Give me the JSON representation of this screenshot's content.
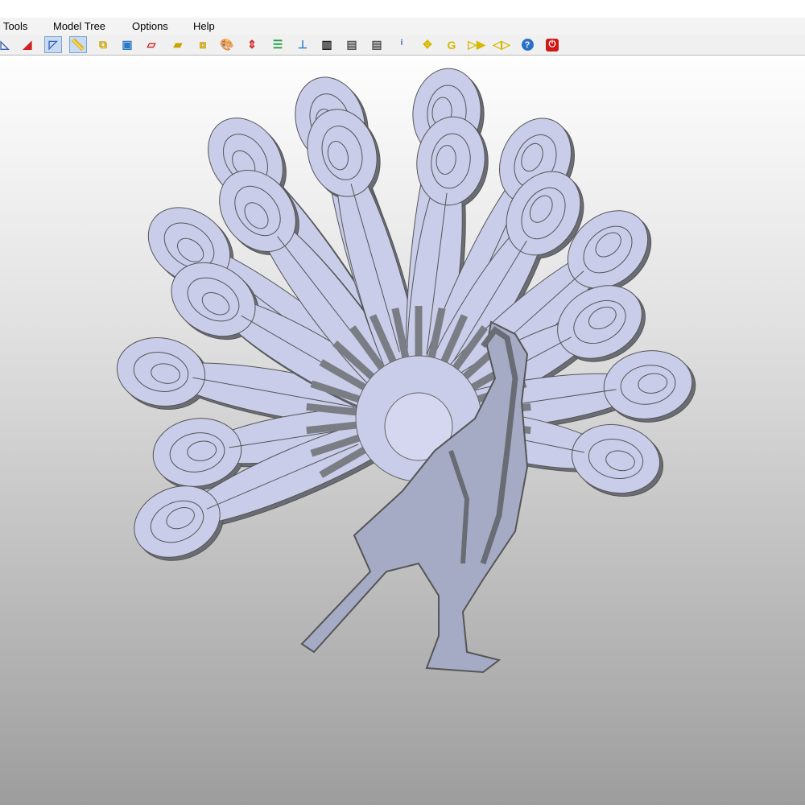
{
  "menu": {
    "items": [
      {
        "label": "Tools",
        "accel": "T"
      },
      {
        "label": "Model Tree",
        "accel": "M"
      },
      {
        "label": "Options",
        "accel": "O"
      },
      {
        "label": "Help",
        "accel": "H"
      }
    ]
  },
  "toolbar": {
    "buttons": [
      {
        "icon": "view-angle-icon",
        "glyph": "◺",
        "color": "#3b63b0"
      },
      {
        "icon": "view-red-icon",
        "glyph": "◢",
        "color": "#d02020"
      },
      {
        "icon": "view-outline-icon",
        "glyph": "◸",
        "color": "#3b63b0",
        "active": true
      },
      {
        "icon": "measure-view-icon",
        "glyph": "📏",
        "color": "#c9a400",
        "active": true
      },
      {
        "icon": "explode-icon",
        "glyph": "⧉",
        "color": "#c9a400"
      },
      {
        "icon": "monitor-icon",
        "glyph": "▣",
        "color": "#2a78c8"
      },
      {
        "icon": "section-plane-icon",
        "glyph": "▱",
        "color": "#d02020"
      },
      {
        "icon": "ruler-icon",
        "glyph": "▰",
        "color": "#c9a400"
      },
      {
        "icon": "move-parts-icon",
        "glyph": "⧈",
        "color": "#c9a400"
      },
      {
        "icon": "paint-palette-icon",
        "glyph": "🎨",
        "color": "#b07030"
      },
      {
        "icon": "transform-icon",
        "glyph": "⇕",
        "color": "#d02020"
      },
      {
        "icon": "layers-icon",
        "glyph": "☰",
        "color": "#20a040"
      },
      {
        "icon": "align-icon",
        "glyph": "⊥",
        "color": "#2a78c8"
      },
      {
        "icon": "film-icon",
        "glyph": "▥",
        "color": "#222222"
      },
      {
        "icon": "properties-icon",
        "glyph": "▤",
        "color": "#555555"
      },
      {
        "icon": "document-props-icon",
        "glyph": "▤",
        "color": "#555555"
      },
      {
        "icon": "info-icon",
        "glyph": "ⁱ",
        "color": "#2a5fb0"
      },
      {
        "icon": "pan-icon",
        "glyph": "✥",
        "color": "#d6b800"
      },
      {
        "icon": "rotate-icon",
        "glyph": "G",
        "color": "#d6b800"
      },
      {
        "icon": "play-forward-icon",
        "glyph": "▷▶",
        "color": "#d6b800"
      },
      {
        "icon": "mirror-icon",
        "glyph": "◁▷",
        "color": "#d6b800"
      },
      {
        "icon": "help-icon",
        "glyph": "?",
        "color": "#ffffff"
      },
      {
        "icon": "power-icon",
        "glyph": "⏻",
        "color": "#ffffff"
      }
    ]
  },
  "colors": {
    "feather": "#c9cde9",
    "edge": "#6b6d75",
    "body": "#a6abc5"
  }
}
